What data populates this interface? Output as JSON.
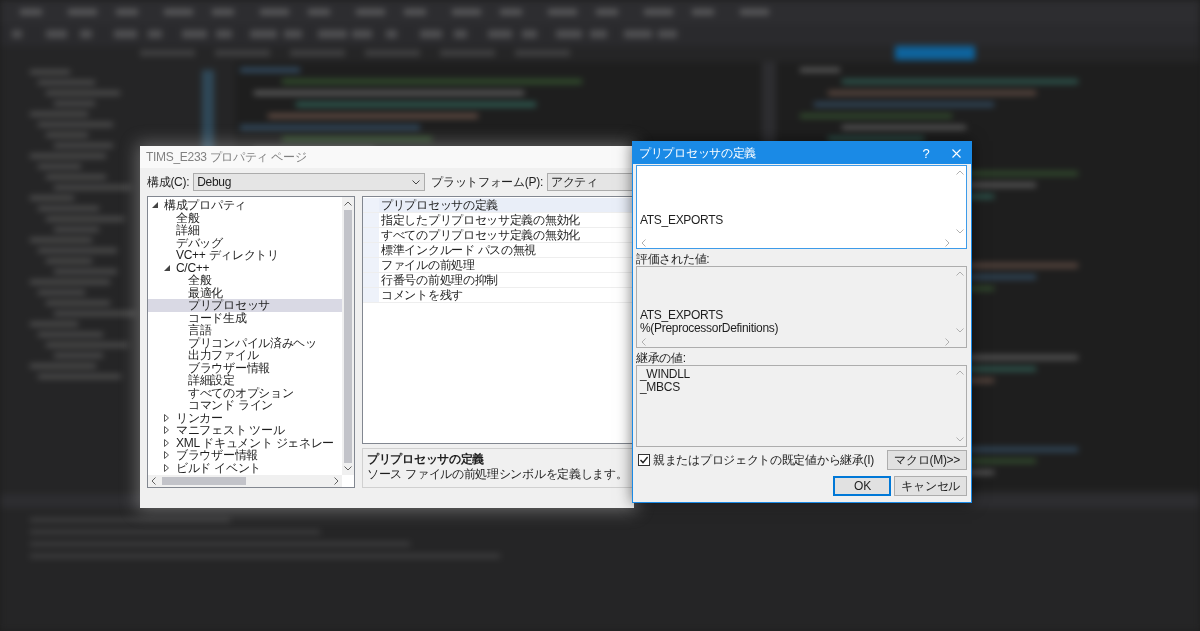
{
  "property_pages": {
    "title": "TIMS_E233 プロパティ ページ",
    "configuration": {
      "label": "構成(C):",
      "value": "Debug"
    },
    "platform": {
      "label": "プラットフォーム(P):",
      "value": "アクティ"
    },
    "tree": [
      {
        "label": "構成プロパティ",
        "expanded": true,
        "selected": false,
        "children": [
          {
            "label": "全般",
            "selected": false
          },
          {
            "label": "詳細",
            "selected": false
          },
          {
            "label": "デバッグ",
            "selected": false
          },
          {
            "label": "VC++ ディレクトリ",
            "selected": false
          },
          {
            "label": "C/C++",
            "expanded": true,
            "selected": false,
            "children": [
              {
                "label": "全般",
                "selected": false
              },
              {
                "label": "最適化",
                "selected": false
              },
              {
                "label": "プリプロセッサ",
                "selected": true
              },
              {
                "label": "コード生成",
                "selected": false
              },
              {
                "label": "言語",
                "selected": false
              },
              {
                "label": "プリコンパイル済みヘッ",
                "selected": false
              },
              {
                "label": "出力ファイル",
                "selected": false
              },
              {
                "label": "ブラウザー情報",
                "selected": false
              },
              {
                "label": "詳細設定",
                "selected": false
              },
              {
                "label": "すべてのオプション",
                "selected": false
              },
              {
                "label": "コマンド ライン",
                "selected": false
              }
            ]
          },
          {
            "label": "リンカー",
            "expanded": false,
            "selected": false
          },
          {
            "label": "マニフェスト ツール",
            "expanded": false,
            "selected": false
          },
          {
            "label": "XML ドキュメント ジェネレー",
            "expanded": false,
            "selected": false
          },
          {
            "label": "ブラウザー情報",
            "expanded": false,
            "selected": false
          },
          {
            "label": "ビルド イベント",
            "expanded": false,
            "selected": false
          }
        ]
      }
    ],
    "properties": [
      {
        "label": "プリプロセッサの定義",
        "selected": true
      },
      {
        "label": "指定したプリプロセッサ定義の無効化",
        "selected": false
      },
      {
        "label": "すべてのプリプロセッサ定義の無効化",
        "selected": false
      },
      {
        "label": "標準インクルード パスの無視",
        "selected": false
      },
      {
        "label": "ファイルの前処理",
        "selected": false
      },
      {
        "label": "行番号の前処理の抑制",
        "selected": false
      },
      {
        "label": "コメントを残す",
        "selected": false
      }
    ],
    "description": {
      "title": "プリプロセッサの定義",
      "text": "ソース ファイルの前処理シンボルを定義します。"
    }
  },
  "definitions_dialog": {
    "title": "プリプロセッサの定義",
    "help_button": "?",
    "definitions": {
      "lines": [
        "ATS_EXPORTS"
      ]
    },
    "evaluated": {
      "label": "評価された値:",
      "lines": [
        "ATS_EXPORTS",
        "%(PreprocessorDefinitions)"
      ]
    },
    "inherited": {
      "label": "継承の値:",
      "lines": [
        "_WINDLL",
        "_MBCS"
      ]
    },
    "inherit_checkbox": {
      "label": "親またはプロジェクトの既定値から継承(I)",
      "checked": true
    },
    "macro_button": {
      "label": "マクロ(M)>>"
    },
    "buttons": [
      {
        "label": "OK",
        "default": true
      },
      {
        "label": "キャンセル",
        "default": false
      }
    ]
  }
}
